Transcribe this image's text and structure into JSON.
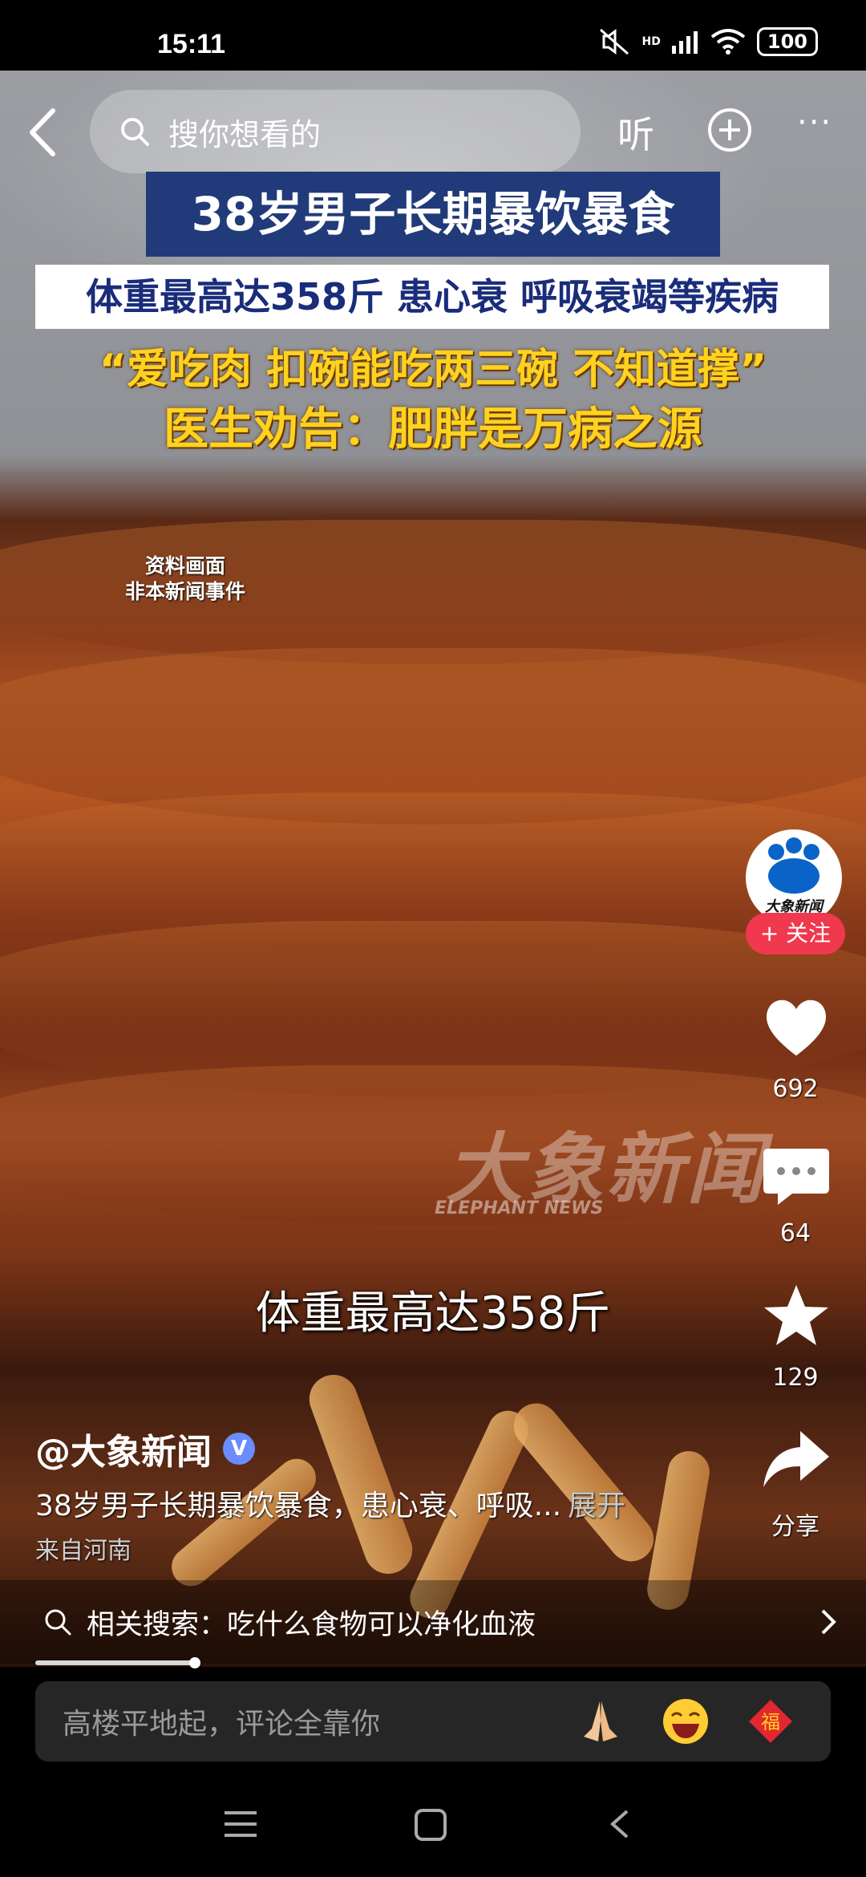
{
  "status_bar": {
    "time": "15:11",
    "battery": "100",
    "network": "HD"
  },
  "top_nav": {
    "search_placeholder": "搜你想看的",
    "listen_label": "听",
    "more_label": "···"
  },
  "video": {
    "headline_1": "38岁男子长期暴饮暴食",
    "headline_2": "体重最高达358斤 患心衰 呼吸衰竭等疾病",
    "headline_3": "“爱吃肉 扣碗能吃两三碗 不知道撑”",
    "headline_4": "医生劝告：肥胖是万病之源",
    "archive_note_1": "资料画面",
    "archive_note_2": "非本新闻事件",
    "watermark_cn": "大象新闻",
    "watermark_en": "ELEPHANT NEWS",
    "subtitle": "体重最高达358斤"
  },
  "right_rail": {
    "avatar_text": "大象新闻",
    "follow_label": "+ 关注",
    "likes": "692",
    "comments": "64",
    "favorites": "129",
    "share_label": "分享"
  },
  "caption": {
    "author": "@大象新闻",
    "verified": "V",
    "description": "38岁男子长期暴饮暴食，患心衰、呼吸...",
    "expand_label": "展开",
    "location": "来自河南"
  },
  "related_search": {
    "label": "相关搜索：吃什么食物可以净化血液"
  },
  "comment_bar": {
    "placeholder": "高楼平地起，评论全靠你",
    "blessing": "福"
  },
  "colors": {
    "headline_bg": "#213a7a",
    "headline_yellow": "#ffd21f",
    "follow_red": "#f0384e",
    "brand_blue": "#0a64c8"
  }
}
